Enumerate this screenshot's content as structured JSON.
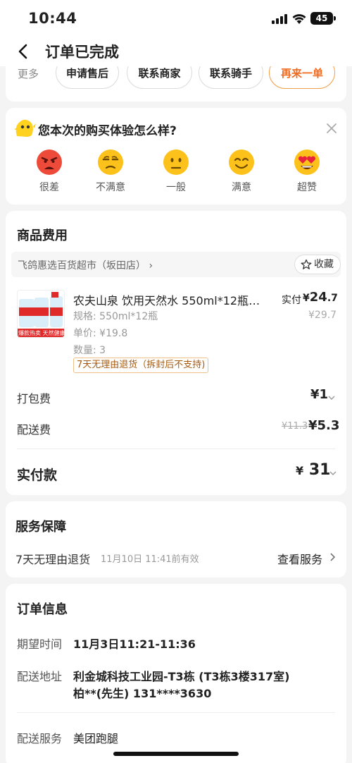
{
  "status_bar": {
    "time": "10:44",
    "battery": "45"
  },
  "header": {
    "title": "订单已完成"
  },
  "actions": {
    "more_label": "更多",
    "buttons": [
      "申请售后",
      "联系商家",
      "联系骑手",
      "再来一单"
    ]
  },
  "rating": {
    "question": "您本次的购买体验怎么样?",
    "options": [
      {
        "label": "很差",
        "icon": "angry-face-icon"
      },
      {
        "label": "不满意",
        "icon": "unamused-face-icon"
      },
      {
        "label": "一般",
        "icon": "neutral-face-icon"
      },
      {
        "label": "满意",
        "icon": "smiling-face-icon"
      },
      {
        "label": "超赞",
        "icon": "heart-eyes-face-icon"
      }
    ]
  },
  "fees": {
    "title": "商品费用",
    "store_name": "飞鸽惠选百货超市（坂田店）",
    "favorite_label": "收藏",
    "product": {
      "name": "农夫山泉 饮用天然水 550ml*12瓶…",
      "paid_label": "实付",
      "paid_symbol": "¥",
      "paid_int": "24",
      "paid_dec": ".7",
      "original_price": "¥29.7",
      "spec": "规格: 550ml*12瓶",
      "unit_price": "单价: ¥19.8",
      "quantity": "数量: 3",
      "return_tag": "7天无理由退货（拆封后不支持)",
      "thumb_text": "爆款热卖 天然健康"
    },
    "packing": {
      "label": "打包费",
      "value": "¥1"
    },
    "delivery": {
      "label": "配送费",
      "original": "¥11.3",
      "value": "¥5.3"
    },
    "total": {
      "label": "实付款",
      "symbol": "¥",
      "value": "31"
    }
  },
  "service": {
    "title": "服务保障",
    "name": "7天无理由退货",
    "deadline": "11月10日 11:41前有效",
    "link": "查看服务"
  },
  "order_info": {
    "title": "订单信息",
    "expected_time_label": "期望时间",
    "expected_time": "11月3日11:21-11:36",
    "address_label": "配送地址",
    "address_line1": "利金城科技工业园-T3栋 (T3栋3楼317室)",
    "address_line2": "柏**(先生) 131****3630",
    "delivery_service_label": "配送服务",
    "delivery_service": "美团跑腿"
  },
  "colors": {
    "accent": "#f06a1f",
    "background": "#f4f4f4"
  }
}
